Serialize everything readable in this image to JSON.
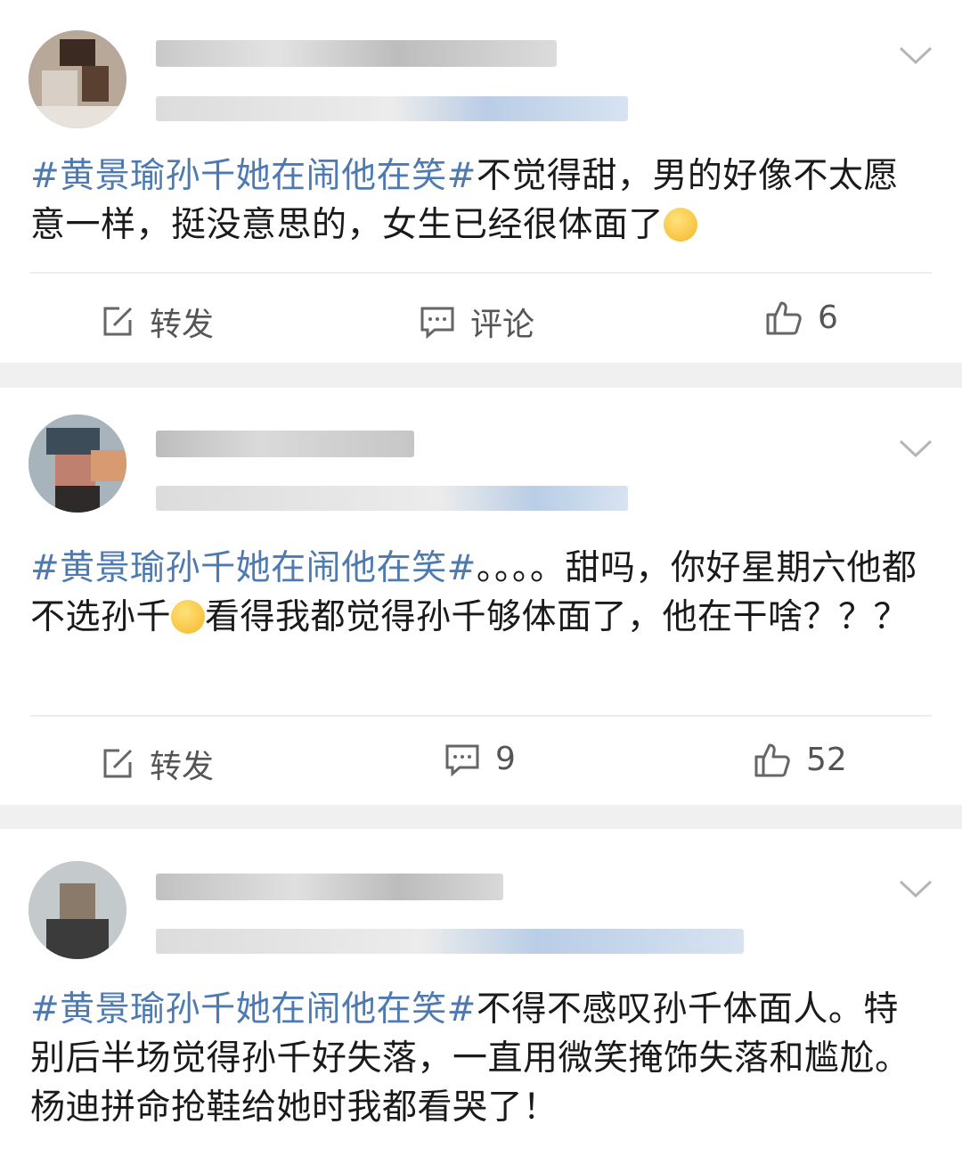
{
  "posts": [
    {
      "hashtag": "#黄景瑜孙千她在闹他在笑#",
      "text_a": "不觉得甜，男的好像不太愿意一样，挺没意思的，女生已经很体面了",
      "emoji_a": "smirk-emoji",
      "text_b": "",
      "actions": {
        "repost_label": "转发",
        "comment_label": "评论",
        "like_count": "6"
      }
    },
    {
      "hashtag": "#黄景瑜孙千她在闹他在笑#",
      "text_a": "。。。。甜吗，你好星期六他都不选孙千",
      "emoji_a": "thinking-emoji",
      "text_b": "看得我都觉得孙千够体面了，他在干啥？？？",
      "actions": {
        "repost_label": "转发",
        "comment_label": "9",
        "like_count": "52"
      }
    },
    {
      "hashtag": "#黄景瑜孙千她在闹他在笑#",
      "text_a": "不得不感叹孙千体面人。特别后半场觉得孙千好失落，一直用微笑掩饰失落和尴尬。杨迪拼命抢鞋给她时我都看哭了！",
      "emoji_a": "",
      "text_b": ""
    }
  ],
  "colors": {
    "hashtag": "#4d7ab0",
    "background": "#f0f0f0",
    "card": "#ffffff"
  },
  "icons": {
    "repost": "compose-icon",
    "comment": "comment-icon",
    "like": "thumbs-up-icon",
    "menu": "chevron-down-icon"
  }
}
